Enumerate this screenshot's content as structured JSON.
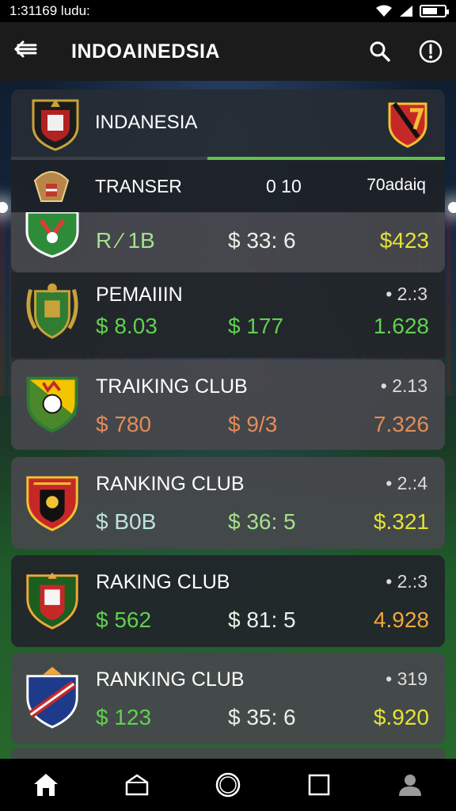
{
  "status_bar": {
    "time": "1:31169 ludu:"
  },
  "app_bar": {
    "back_label": "←",
    "title": "INDOAINEDSIA"
  },
  "header": {
    "team_name": "INDANESIA"
  },
  "sub_header": {
    "left": "TRANSER",
    "middle": "0 10",
    "right": "70adaiq"
  },
  "rows": [
    {
      "label": "",
      "rank": "",
      "v1": "R ⁄ 1B",
      "v2": "$ 33: 6",
      "v3": "$423",
      "v1_color": "c-lgreen",
      "v2_color": "c-gwhite",
      "v3_color": "c-yellow"
    },
    {
      "label": "PEMAIIIN",
      "rank": "• 2.:3",
      "v1": "$ 8.03",
      "v2": "$ 177",
      "v3": "1.628",
      "v1_color": "c-green",
      "v2_color": "c-green",
      "v3_color": "c-green"
    },
    {
      "label": "TRAIKING CLUB",
      "rank": "• 2.13",
      "v1": "$ 780",
      "v2": "$ 9/3",
      "v3": "7.326",
      "v1_color": "c-orange",
      "v2_color": "c-orange",
      "v3_color": "c-orange"
    },
    {
      "label": "RANKING CLUB",
      "rank": "• 2.:4",
      "v1": "$ B0B",
      "v2": "$ 36: 5",
      "v3": "$.321",
      "v1_color": "c-bluegray",
      "v2_color": "c-lgreen",
      "v3_color": "c-yellow"
    },
    {
      "label": "RAKING CLUB",
      "rank": "• 2.:3",
      "v1": "$ 562",
      "v2": "$ 81: 5",
      "v3": "4.928",
      "v1_color": "c-green",
      "v2_color": "c-gwhite",
      "v3_color": "c-gold"
    },
    {
      "label": "RANKING CLUB",
      "rank": "• 319",
      "v1": "$ 123",
      "v2": "$ 35: 6",
      "v3": "$.920",
      "v1_color": "c-green",
      "v2_color": "c-gwhite",
      "v3_color": "c-yellow"
    }
  ],
  "nav": {
    "icons": [
      "home-icon",
      "box-icon",
      "circle-icon",
      "square-icon",
      "profile-icon"
    ]
  }
}
